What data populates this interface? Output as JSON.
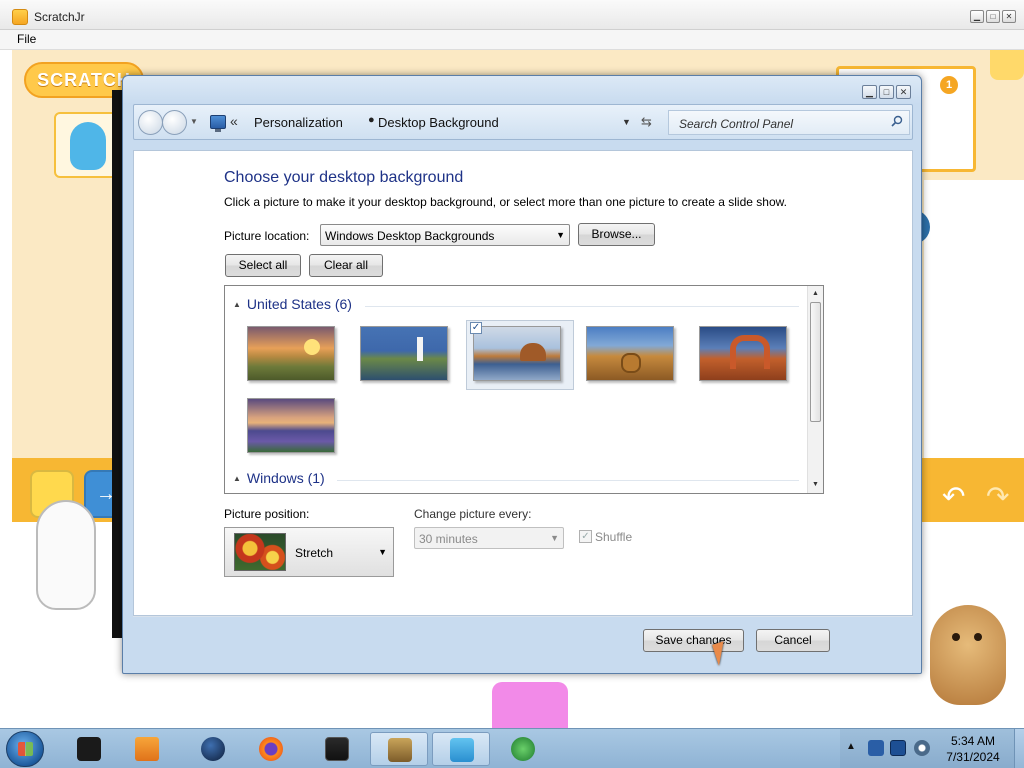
{
  "scratchjr": {
    "title": "ScratchJr",
    "menu": [
      "File"
    ],
    "logo_text": "SCRATCH",
    "page_number": "1"
  },
  "dialog": {
    "breadcrumb": [
      "Personalization",
      "Desktop Background"
    ],
    "search_placeholder": "Search Control Panel",
    "heading": "Choose your desktop background",
    "description": "Click a picture to make it your desktop background, or select more than one picture to create a slide show.",
    "picture_location_label": "Picture location:",
    "picture_location_value": "Windows Desktop Backgrounds",
    "browse_label": "Browse...",
    "select_all_label": "Select all",
    "clear_all_label": "Clear all",
    "groups": [
      {
        "label": "United States (6)",
        "expanded": true
      },
      {
        "label": "Windows (1)",
        "expanded": true
      }
    ],
    "thumbnails": [
      {
        "name": "prairie-sunset",
        "selected": false
      },
      {
        "name": "lighthouse-coast",
        "selected": false
      },
      {
        "name": "rock-lake-reflection",
        "selected": true
      },
      {
        "name": "hay-bale-field",
        "selected": false
      },
      {
        "name": "delicate-arch",
        "selected": false
      },
      {
        "name": "lupine-lake",
        "selected": false
      }
    ],
    "picture_position_label": "Picture position:",
    "picture_position_value": "Stretch",
    "change_every_label": "Change picture every:",
    "change_every_value": "30 minutes",
    "shuffle_label": "Shuffle",
    "shuffle_checked": true,
    "save_label": "Save changes",
    "cancel_label": "Cancel"
  },
  "taskbar": {
    "time": "5:34 AM",
    "date": "7/31/2024"
  },
  "colors": {
    "heading_blue": "#1e3287",
    "scratch_orange": "#f7b733",
    "taskbar_blue": "#9fbfdb"
  }
}
